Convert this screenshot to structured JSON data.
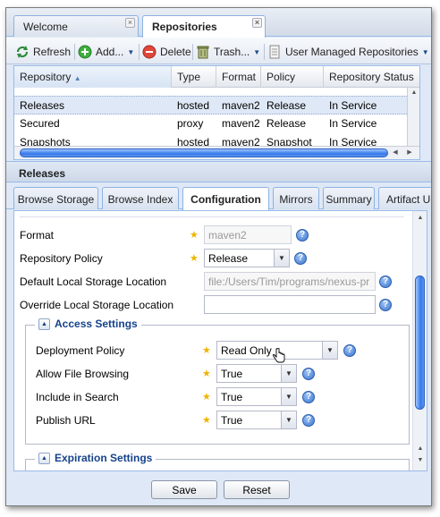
{
  "top_tabs": [
    {
      "label": "Welcome",
      "active": false
    },
    {
      "label": "Repositories",
      "active": true
    }
  ],
  "toolbar": {
    "refresh": "Refresh",
    "add": "Add...",
    "delete": "Delete",
    "trash": "Trash...",
    "user_managed": "User Managed Repositories"
  },
  "grid": {
    "columns": [
      "Repository",
      "Type",
      "Format",
      "Policy",
      "Repository Status"
    ],
    "sort_indicator": "▲",
    "rows": [
      {
        "repository": "Releases",
        "type": "hosted",
        "format": "maven2",
        "policy": "Release",
        "status": "In Service",
        "selected": true
      },
      {
        "repository": "Secured",
        "type": "proxy",
        "format": "maven2",
        "policy": "Release",
        "status": "In Service",
        "selected": false
      },
      {
        "repository": "Snapshots",
        "type": "hosted",
        "format": "maven2",
        "policy": "Snapshot",
        "status": "In Service",
        "selected": false
      }
    ]
  },
  "panel": {
    "title": "Releases",
    "tabs": [
      "Browse Storage",
      "Browse Index",
      "Configuration",
      "Mirrors",
      "Summary",
      "Artifact U"
    ],
    "active_tab": "Configuration"
  },
  "form": {
    "format_label": "Format",
    "format_value": "maven2",
    "policy_label": "Repository Policy",
    "policy_value": "Release",
    "default_storage_label": "Default Local Storage Location",
    "default_storage_value": "file:/Users/Tim/programs/nexus-pr",
    "override_storage_label": "Override Local Storage Location",
    "override_storage_value": "",
    "access_settings": {
      "title": "Access Settings",
      "deployment_policy_label": "Deployment Policy",
      "deployment_policy_value": "Read Only",
      "allow_browsing_label": "Allow File Browsing",
      "allow_browsing_value": "True",
      "include_search_label": "Include in Search",
      "include_search_value": "True",
      "publish_url_label": "Publish URL",
      "publish_url_value": "True"
    },
    "expiration_settings": {
      "title": "Expiration Settings"
    }
  },
  "footer": {
    "save": "Save",
    "reset": "Reset"
  },
  "glyphs": {
    "required_star": "★",
    "help": "?",
    "dropdown": "▼",
    "close": "×",
    "collapse": "▲",
    "scroll_up": "▲",
    "scroll_down": "▼",
    "scroll_left": "◀",
    "scroll_right": "▶"
  }
}
